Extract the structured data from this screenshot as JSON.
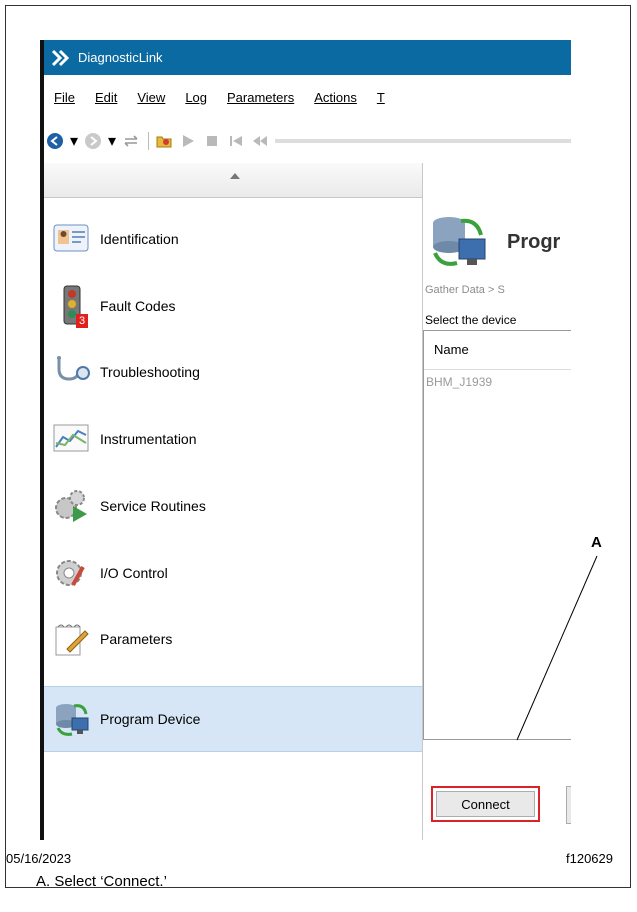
{
  "window": {
    "title": "DiagnosticLink"
  },
  "menu": [
    "File",
    "Edit",
    "View",
    "Log",
    "Parameters",
    "Actions",
    "T"
  ],
  "toolbar_icons": [
    "back-icon",
    "forward-icon",
    "transfer-icon",
    "folder-icon",
    "play-icon",
    "stop-icon",
    "skip-back-icon",
    "rewind-icon"
  ],
  "sidebar": {
    "items": [
      {
        "label": "Identification",
        "icon": "identification-icon"
      },
      {
        "label": "Fault Codes",
        "icon": "fault-codes-icon",
        "badge": "3"
      },
      {
        "label": "Troubleshooting",
        "icon": "stethoscope-icon"
      },
      {
        "label": "Instrumentation",
        "icon": "chart-icon"
      },
      {
        "label": "Service Routines",
        "icon": "gears-play-icon"
      },
      {
        "label": "I/O Control",
        "icon": "gears-tool-icon"
      },
      {
        "label": "Parameters",
        "icon": "notepad-pencil-icon"
      },
      {
        "label": "Program Device",
        "icon": "program-device-icon",
        "selected": true
      }
    ]
  },
  "main": {
    "title": "Progr",
    "breadcrumb": "Gather Data > S",
    "instruction": "Select the device",
    "list_header": "Name",
    "rows": [
      "BHM_J1939"
    ],
    "connect_label": "Connect"
  },
  "callout": {
    "label": "A"
  },
  "footer": {
    "date": "05/16/2023",
    "figure_id": "f120629"
  },
  "caption": "A. Select ‘Connect.’",
  "colors": {
    "titlebar": "#0b6aa2",
    "selected": "#d6e6f7",
    "highlight": "#d9232a"
  }
}
